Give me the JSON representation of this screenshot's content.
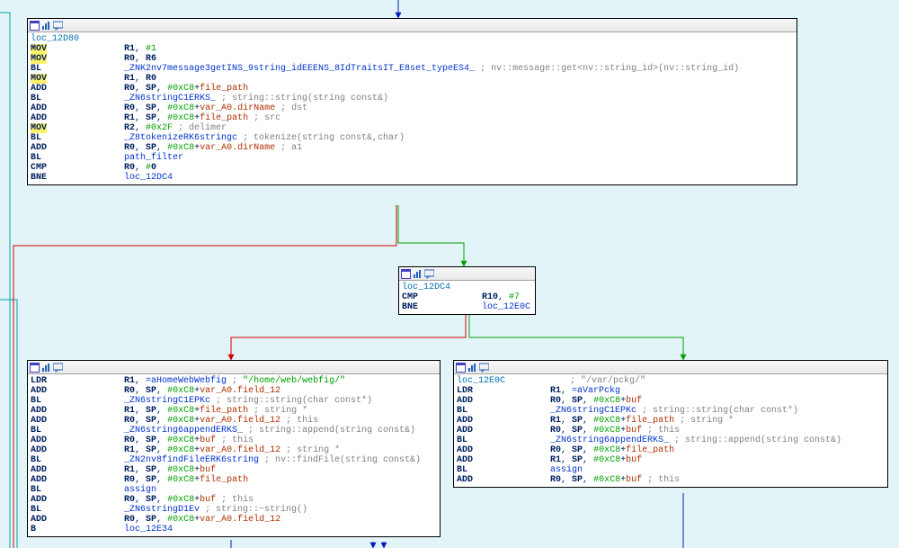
{
  "graph": {
    "block1": {
      "label": "loc_12D80",
      "lines": [
        {
          "mn": "MOV",
          "hl": true,
          "ops": [
            {
              "t": "reg",
              "v": "R1"
            },
            {
              "t": "p",
              "v": ", "
            },
            {
              "t": "hex",
              "v": "#"
            },
            {
              "t": "immhl",
              "v": "1"
            }
          ]
        },
        {
          "mn": "MOV",
          "hl": true,
          "ops": [
            {
              "t": "reg",
              "v": "R0"
            },
            {
              "t": "p",
              "v": ", "
            },
            {
              "t": "reg",
              "v": "R6"
            }
          ]
        },
        {
          "mn": "BL",
          "ops": [
            {
              "t": "sym",
              "v": "_ZNK2nv7message3getINS_9string_idEEENS_8IdTraitsIT_E8set_typeES4_"
            },
            {
              "t": "cmt",
              "v": " ; nv::message::get<nv::string_id>(nv::string_id)"
            }
          ]
        },
        {
          "mn": "MOV",
          "hl": true,
          "ops": [
            {
              "t": "reg",
              "v": "R1"
            },
            {
              "t": "p",
              "v": ", "
            },
            {
              "t": "reg",
              "v": "R0"
            }
          ]
        },
        {
          "mn": "ADD",
          "ops": [
            {
              "t": "reg",
              "v": "R0"
            },
            {
              "t": "p",
              "v": ", "
            },
            {
              "t": "reg",
              "v": "SP"
            },
            {
              "t": "p",
              "v": ", "
            },
            {
              "t": "hex",
              "v": "#0xC8"
            },
            {
              "t": "p",
              "v": "+"
            },
            {
              "t": "field",
              "v": "file_path"
            }
          ]
        },
        {
          "mn": "BL",
          "ops": [
            {
              "t": "sym",
              "v": "_ZN6stringC1ERKS_"
            },
            {
              "t": "cmt",
              "v": " ; string::string(string const&)"
            }
          ]
        },
        {
          "mn": "ADD",
          "ops": [
            {
              "t": "reg",
              "v": "R0"
            },
            {
              "t": "p",
              "v": ", "
            },
            {
              "t": "reg",
              "v": "SP"
            },
            {
              "t": "p",
              "v": ", "
            },
            {
              "t": "hex",
              "v": "#0xC8"
            },
            {
              "t": "p",
              "v": "+"
            },
            {
              "t": "field",
              "v": "var_A0.dirName"
            },
            {
              "t": "cmt",
              "v": " ; dst"
            }
          ]
        },
        {
          "mn": "ADD",
          "ops": [
            {
              "t": "reg",
              "v": "R1"
            },
            {
              "t": "p",
              "v": ", "
            },
            {
              "t": "reg",
              "v": "SP"
            },
            {
              "t": "p",
              "v": ", "
            },
            {
              "t": "hex",
              "v": "#0xC8"
            },
            {
              "t": "p",
              "v": "+"
            },
            {
              "t": "field",
              "v": "file_path"
            },
            {
              "t": "cmt",
              "v": " ; src"
            }
          ]
        },
        {
          "mn": "MOV",
          "hl": true,
          "ops": [
            {
              "t": "reg",
              "v": "R2"
            },
            {
              "t": "p",
              "v": ", "
            },
            {
              "t": "hex",
              "v": "#0x2F"
            },
            {
              "t": "cmt",
              "v": " ; delimer"
            }
          ]
        },
        {
          "mn": "BL",
          "ops": [
            {
              "t": "sym",
              "v": "_Z8tokenizeRK6stringc"
            },
            {
              "t": "cmt",
              "v": " ; tokenize(string const&,char)"
            }
          ]
        },
        {
          "mn": "ADD",
          "ops": [
            {
              "t": "reg",
              "v": "R0"
            },
            {
              "t": "p",
              "v": ", "
            },
            {
              "t": "reg",
              "v": "SP"
            },
            {
              "t": "p",
              "v": ", "
            },
            {
              "t": "hex",
              "v": "#0xC8"
            },
            {
              "t": "p",
              "v": "+"
            },
            {
              "t": "field",
              "v": "var_A0.dirName"
            },
            {
              "t": "cmt",
              "v": " ; a1"
            }
          ]
        },
        {
          "mn": "BL",
          "ops": [
            {
              "t": "sym",
              "v": "path_filter"
            }
          ]
        },
        {
          "mn": "CMP",
          "ops": [
            {
              "t": "reg",
              "v": "R0"
            },
            {
              "t": "p",
              "v": ", "
            },
            {
              "t": "hex",
              "v": "#"
            },
            {
              "t": "reg",
              "v": "0"
            }
          ]
        },
        {
          "mn": "BNE",
          "ops": [
            {
              "t": "sym",
              "v": "loc_12DC4"
            }
          ]
        }
      ]
    },
    "block2": {
      "label": "loc_12DC4",
      "lines": [
        {
          "mn": "CMP",
          "ops": [
            {
              "t": "reg",
              "v": "R10"
            },
            {
              "t": "p",
              "v": ", "
            },
            {
              "t": "hex",
              "v": "#"
            },
            {
              "t": "immhl",
              "v": "7"
            }
          ]
        },
        {
          "mn": "BNE",
          "ops": [
            {
              "t": "sym",
              "v": "loc_12E0C"
            }
          ]
        }
      ]
    },
    "block3": {
      "lines": [
        {
          "mn": "LDR",
          "ops": [
            {
              "t": "reg",
              "v": "R1"
            },
            {
              "t": "p",
              "v": ", "
            },
            {
              "t": "sym",
              "v": "=aHomeWebWebfig"
            },
            {
              "t": "cmt",
              "v": " ; "
            },
            {
              "t": "str",
              "v": "\"/home/web/webfig/\""
            }
          ]
        },
        {
          "mn": "ADD",
          "ops": [
            {
              "t": "reg",
              "v": "R0"
            },
            {
              "t": "p",
              "v": ", "
            },
            {
              "t": "reg",
              "v": "SP"
            },
            {
              "t": "p",
              "v": ", "
            },
            {
              "t": "hex",
              "v": "#0xC8"
            },
            {
              "t": "p",
              "v": "+"
            },
            {
              "t": "field",
              "v": "var_A0.field_12"
            }
          ]
        },
        {
          "mn": "BL",
          "ops": [
            {
              "t": "sym",
              "v": "_ZN6stringC1EPKc"
            },
            {
              "t": "cmt",
              "v": " ; string::string(char const*)"
            }
          ]
        },
        {
          "mn": "ADD",
          "ops": [
            {
              "t": "reg",
              "v": "R1"
            },
            {
              "t": "p",
              "v": ", "
            },
            {
              "t": "reg",
              "v": "SP"
            },
            {
              "t": "p",
              "v": ", "
            },
            {
              "t": "hex",
              "v": "#0xC8"
            },
            {
              "t": "p",
              "v": "+"
            },
            {
              "t": "field",
              "v": "file_path"
            },
            {
              "t": "cmt",
              "v": " ; string *"
            }
          ]
        },
        {
          "mn": "ADD",
          "ops": [
            {
              "t": "reg",
              "v": "R0"
            },
            {
              "t": "p",
              "v": ", "
            },
            {
              "t": "reg",
              "v": "SP"
            },
            {
              "t": "p",
              "v": ", "
            },
            {
              "t": "hex",
              "v": "#0xC8"
            },
            {
              "t": "p",
              "v": "+"
            },
            {
              "t": "field",
              "v": "var_A0.field_12"
            },
            {
              "t": "cmt",
              "v": " ; this"
            }
          ]
        },
        {
          "mn": "BL",
          "ops": [
            {
              "t": "sym",
              "v": "_ZN6string6appendERKS_"
            },
            {
              "t": "cmt",
              "v": " ; string::append(string const&)"
            }
          ]
        },
        {
          "mn": "ADD",
          "ops": [
            {
              "t": "reg",
              "v": "R0"
            },
            {
              "t": "p",
              "v": ", "
            },
            {
              "t": "reg",
              "v": "SP"
            },
            {
              "t": "p",
              "v": ", "
            },
            {
              "t": "hex",
              "v": "#0xC8"
            },
            {
              "t": "p",
              "v": "+"
            },
            {
              "t": "field",
              "v": "buf"
            },
            {
              "t": "cmt",
              "v": " ; this"
            }
          ]
        },
        {
          "mn": "ADD",
          "ops": [
            {
              "t": "reg",
              "v": "R1"
            },
            {
              "t": "p",
              "v": ", "
            },
            {
              "t": "reg",
              "v": "SP"
            },
            {
              "t": "p",
              "v": ", "
            },
            {
              "t": "hex",
              "v": "#0xC8"
            },
            {
              "t": "p",
              "v": "+"
            },
            {
              "t": "field",
              "v": "var_A0.field_12"
            },
            {
              "t": "cmt",
              "v": " ; string *"
            }
          ]
        },
        {
          "mn": "BL",
          "ops": [
            {
              "t": "sym",
              "v": "_ZN2nv8findFileERK6string"
            },
            {
              "t": "cmt",
              "v": " ; nv::findFile(string const&)"
            }
          ]
        },
        {
          "mn": "ADD",
          "ops": [
            {
              "t": "reg",
              "v": "R1"
            },
            {
              "t": "p",
              "v": ", "
            },
            {
              "t": "reg",
              "v": "SP"
            },
            {
              "t": "p",
              "v": ", "
            },
            {
              "t": "hex",
              "v": "#0xC8"
            },
            {
              "t": "p",
              "v": "+"
            },
            {
              "t": "field",
              "v": "buf"
            }
          ]
        },
        {
          "mn": "ADD",
          "ops": [
            {
              "t": "reg",
              "v": "R0"
            },
            {
              "t": "p",
              "v": ", "
            },
            {
              "t": "reg",
              "v": "SP"
            },
            {
              "t": "p",
              "v": ", "
            },
            {
              "t": "hex",
              "v": "#0xC8"
            },
            {
              "t": "p",
              "v": "+"
            },
            {
              "t": "field",
              "v": "file_path"
            }
          ]
        },
        {
          "mn": "BL",
          "ops": [
            {
              "t": "sym",
              "v": "assign"
            }
          ]
        },
        {
          "mn": "ADD",
          "ops": [
            {
              "t": "reg",
              "v": "R0"
            },
            {
              "t": "p",
              "v": ", "
            },
            {
              "t": "reg",
              "v": "SP"
            },
            {
              "t": "p",
              "v": ", "
            },
            {
              "t": "hex",
              "v": "#0xC8"
            },
            {
              "t": "p",
              "v": "+"
            },
            {
              "t": "field",
              "v": "buf"
            },
            {
              "t": "cmt",
              "v": " ; this"
            }
          ]
        },
        {
          "mn": "BL",
          "ops": [
            {
              "t": "sym",
              "v": "_ZN6stringD1Ev"
            },
            {
              "t": "cmt",
              "v": " ; string::~string()"
            }
          ]
        },
        {
          "mn": "ADD",
          "ops": [
            {
              "t": "reg",
              "v": "R0"
            },
            {
              "t": "p",
              "v": ", "
            },
            {
              "t": "reg",
              "v": "SP"
            },
            {
              "t": "p",
              "v": ", "
            },
            {
              "t": "hex",
              "v": "#0xC8"
            },
            {
              "t": "p",
              "v": "+"
            },
            {
              "t": "field",
              "v": "var_A0.field_12"
            }
          ]
        },
        {
          "mn": "B",
          "ops": [
            {
              "t": "sym",
              "v": "loc_12E34"
            }
          ]
        }
      ]
    },
    "block4": {
      "label": "loc_12E0C",
      "label_comment": "; \"/var/pckg/\"",
      "lines": [
        {
          "mn": "LDR",
          "ops": [
            {
              "t": "reg",
              "v": "R1"
            },
            {
              "t": "p",
              "v": ", "
            },
            {
              "t": "sym",
              "v": "=aVarPckg"
            }
          ]
        },
        {
          "mn": "ADD",
          "ops": [
            {
              "t": "reg",
              "v": "R0"
            },
            {
              "t": "p",
              "v": ", "
            },
            {
              "t": "reg",
              "v": "SP"
            },
            {
              "t": "p",
              "v": ", "
            },
            {
              "t": "hex",
              "v": "#0xC8"
            },
            {
              "t": "p",
              "v": "+"
            },
            {
              "t": "field",
              "v": "buf"
            }
          ]
        },
        {
          "mn": "BL",
          "ops": [
            {
              "t": "sym",
              "v": "_ZN6stringC1EPKc"
            },
            {
              "t": "cmt",
              "v": " ; string::string(char const*)"
            }
          ]
        },
        {
          "mn": "ADD",
          "ops": [
            {
              "t": "reg",
              "v": "R1"
            },
            {
              "t": "p",
              "v": ", "
            },
            {
              "t": "reg",
              "v": "SP"
            },
            {
              "t": "p",
              "v": ", "
            },
            {
              "t": "hex",
              "v": "#0xC8"
            },
            {
              "t": "p",
              "v": "+"
            },
            {
              "t": "field",
              "v": "file_path"
            },
            {
              "t": "cmt",
              "v": " ; string *"
            }
          ]
        },
        {
          "mn": "ADD",
          "ops": [
            {
              "t": "reg",
              "v": "R0"
            },
            {
              "t": "p",
              "v": ", "
            },
            {
              "t": "reg",
              "v": "SP"
            },
            {
              "t": "p",
              "v": ", "
            },
            {
              "t": "hex",
              "v": "#0xC8"
            },
            {
              "t": "p",
              "v": "+"
            },
            {
              "t": "field",
              "v": "buf"
            },
            {
              "t": "cmt",
              "v": " ; this"
            }
          ]
        },
        {
          "mn": "BL",
          "ops": [
            {
              "t": "sym",
              "v": "_ZN6string6appendERKS_"
            },
            {
              "t": "cmt",
              "v": " ; string::append(string const&)"
            }
          ]
        },
        {
          "mn": "ADD",
          "ops": [
            {
              "t": "reg",
              "v": "R0"
            },
            {
              "t": "p",
              "v": ", "
            },
            {
              "t": "reg",
              "v": "SP"
            },
            {
              "t": "p",
              "v": ", "
            },
            {
              "t": "hex",
              "v": "#0xC8"
            },
            {
              "t": "p",
              "v": "+"
            },
            {
              "t": "field",
              "v": "file_path"
            }
          ]
        },
        {
          "mn": "ADD",
          "ops": [
            {
              "t": "reg",
              "v": "R1"
            },
            {
              "t": "p",
              "v": ", "
            },
            {
              "t": "reg",
              "v": "SP"
            },
            {
              "t": "p",
              "v": ", "
            },
            {
              "t": "hex",
              "v": "#0xC8"
            },
            {
              "t": "p",
              "v": "+"
            },
            {
              "t": "field",
              "v": "buf"
            }
          ]
        },
        {
          "mn": "BL",
          "ops": [
            {
              "t": "sym",
              "v": "assign"
            }
          ]
        },
        {
          "mn": "ADD",
          "ops": [
            {
              "t": "reg",
              "v": "R0"
            },
            {
              "t": "p",
              "v": ", "
            },
            {
              "t": "reg",
              "v": "SP"
            },
            {
              "t": "p",
              "v": ", "
            },
            {
              "t": "hex",
              "v": "#0xC8"
            },
            {
              "t": "p",
              "v": "+"
            },
            {
              "t": "field",
              "v": "buf"
            },
            {
              "t": "cmt",
              "v": " ; this"
            }
          ]
        }
      ]
    }
  }
}
